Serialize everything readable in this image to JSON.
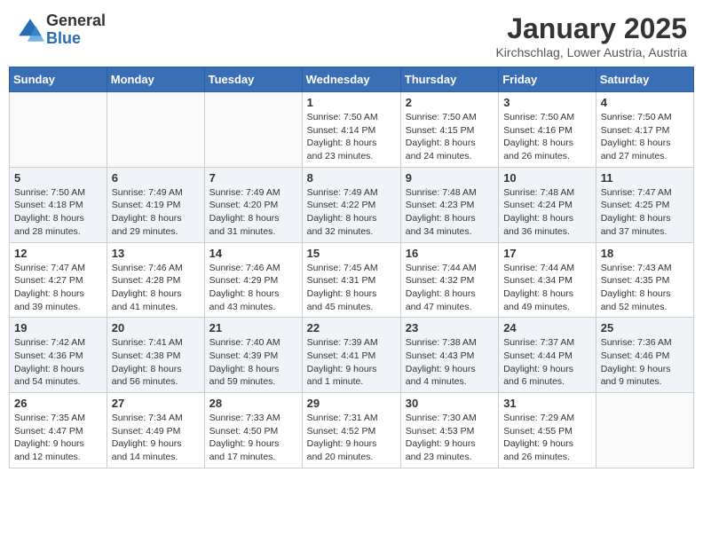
{
  "header": {
    "logo_general": "General",
    "logo_blue": "Blue",
    "month_title": "January 2025",
    "location": "Kirchschlag, Lower Austria, Austria"
  },
  "weekdays": [
    "Sunday",
    "Monday",
    "Tuesday",
    "Wednesday",
    "Thursday",
    "Friday",
    "Saturday"
  ],
  "weeks": [
    [
      {
        "day": "",
        "info": ""
      },
      {
        "day": "",
        "info": ""
      },
      {
        "day": "",
        "info": ""
      },
      {
        "day": "1",
        "info": "Sunrise: 7:50 AM\nSunset: 4:14 PM\nDaylight: 8 hours\nand 23 minutes."
      },
      {
        "day": "2",
        "info": "Sunrise: 7:50 AM\nSunset: 4:15 PM\nDaylight: 8 hours\nand 24 minutes."
      },
      {
        "day": "3",
        "info": "Sunrise: 7:50 AM\nSunset: 4:16 PM\nDaylight: 8 hours\nand 26 minutes."
      },
      {
        "day": "4",
        "info": "Sunrise: 7:50 AM\nSunset: 4:17 PM\nDaylight: 8 hours\nand 27 minutes."
      }
    ],
    [
      {
        "day": "5",
        "info": "Sunrise: 7:50 AM\nSunset: 4:18 PM\nDaylight: 8 hours\nand 28 minutes."
      },
      {
        "day": "6",
        "info": "Sunrise: 7:49 AM\nSunset: 4:19 PM\nDaylight: 8 hours\nand 29 minutes."
      },
      {
        "day": "7",
        "info": "Sunrise: 7:49 AM\nSunset: 4:20 PM\nDaylight: 8 hours\nand 31 minutes."
      },
      {
        "day": "8",
        "info": "Sunrise: 7:49 AM\nSunset: 4:22 PM\nDaylight: 8 hours\nand 32 minutes."
      },
      {
        "day": "9",
        "info": "Sunrise: 7:48 AM\nSunset: 4:23 PM\nDaylight: 8 hours\nand 34 minutes."
      },
      {
        "day": "10",
        "info": "Sunrise: 7:48 AM\nSunset: 4:24 PM\nDaylight: 8 hours\nand 36 minutes."
      },
      {
        "day": "11",
        "info": "Sunrise: 7:47 AM\nSunset: 4:25 PM\nDaylight: 8 hours\nand 37 minutes."
      }
    ],
    [
      {
        "day": "12",
        "info": "Sunrise: 7:47 AM\nSunset: 4:27 PM\nDaylight: 8 hours\nand 39 minutes."
      },
      {
        "day": "13",
        "info": "Sunrise: 7:46 AM\nSunset: 4:28 PM\nDaylight: 8 hours\nand 41 minutes."
      },
      {
        "day": "14",
        "info": "Sunrise: 7:46 AM\nSunset: 4:29 PM\nDaylight: 8 hours\nand 43 minutes."
      },
      {
        "day": "15",
        "info": "Sunrise: 7:45 AM\nSunset: 4:31 PM\nDaylight: 8 hours\nand 45 minutes."
      },
      {
        "day": "16",
        "info": "Sunrise: 7:44 AM\nSunset: 4:32 PM\nDaylight: 8 hours\nand 47 minutes."
      },
      {
        "day": "17",
        "info": "Sunrise: 7:44 AM\nSunset: 4:34 PM\nDaylight: 8 hours\nand 49 minutes."
      },
      {
        "day": "18",
        "info": "Sunrise: 7:43 AM\nSunset: 4:35 PM\nDaylight: 8 hours\nand 52 minutes."
      }
    ],
    [
      {
        "day": "19",
        "info": "Sunrise: 7:42 AM\nSunset: 4:36 PM\nDaylight: 8 hours\nand 54 minutes."
      },
      {
        "day": "20",
        "info": "Sunrise: 7:41 AM\nSunset: 4:38 PM\nDaylight: 8 hours\nand 56 minutes."
      },
      {
        "day": "21",
        "info": "Sunrise: 7:40 AM\nSunset: 4:39 PM\nDaylight: 8 hours\nand 59 minutes."
      },
      {
        "day": "22",
        "info": "Sunrise: 7:39 AM\nSunset: 4:41 PM\nDaylight: 9 hours\nand 1 minute."
      },
      {
        "day": "23",
        "info": "Sunrise: 7:38 AM\nSunset: 4:43 PM\nDaylight: 9 hours\nand 4 minutes."
      },
      {
        "day": "24",
        "info": "Sunrise: 7:37 AM\nSunset: 4:44 PM\nDaylight: 9 hours\nand 6 minutes."
      },
      {
        "day": "25",
        "info": "Sunrise: 7:36 AM\nSunset: 4:46 PM\nDaylight: 9 hours\nand 9 minutes."
      }
    ],
    [
      {
        "day": "26",
        "info": "Sunrise: 7:35 AM\nSunset: 4:47 PM\nDaylight: 9 hours\nand 12 minutes."
      },
      {
        "day": "27",
        "info": "Sunrise: 7:34 AM\nSunset: 4:49 PM\nDaylight: 9 hours\nand 14 minutes."
      },
      {
        "day": "28",
        "info": "Sunrise: 7:33 AM\nSunset: 4:50 PM\nDaylight: 9 hours\nand 17 minutes."
      },
      {
        "day": "29",
        "info": "Sunrise: 7:31 AM\nSunset: 4:52 PM\nDaylight: 9 hours\nand 20 minutes."
      },
      {
        "day": "30",
        "info": "Sunrise: 7:30 AM\nSunset: 4:53 PM\nDaylight: 9 hours\nand 23 minutes."
      },
      {
        "day": "31",
        "info": "Sunrise: 7:29 AM\nSunset: 4:55 PM\nDaylight: 9 hours\nand 26 minutes."
      },
      {
        "day": "",
        "info": ""
      }
    ]
  ]
}
